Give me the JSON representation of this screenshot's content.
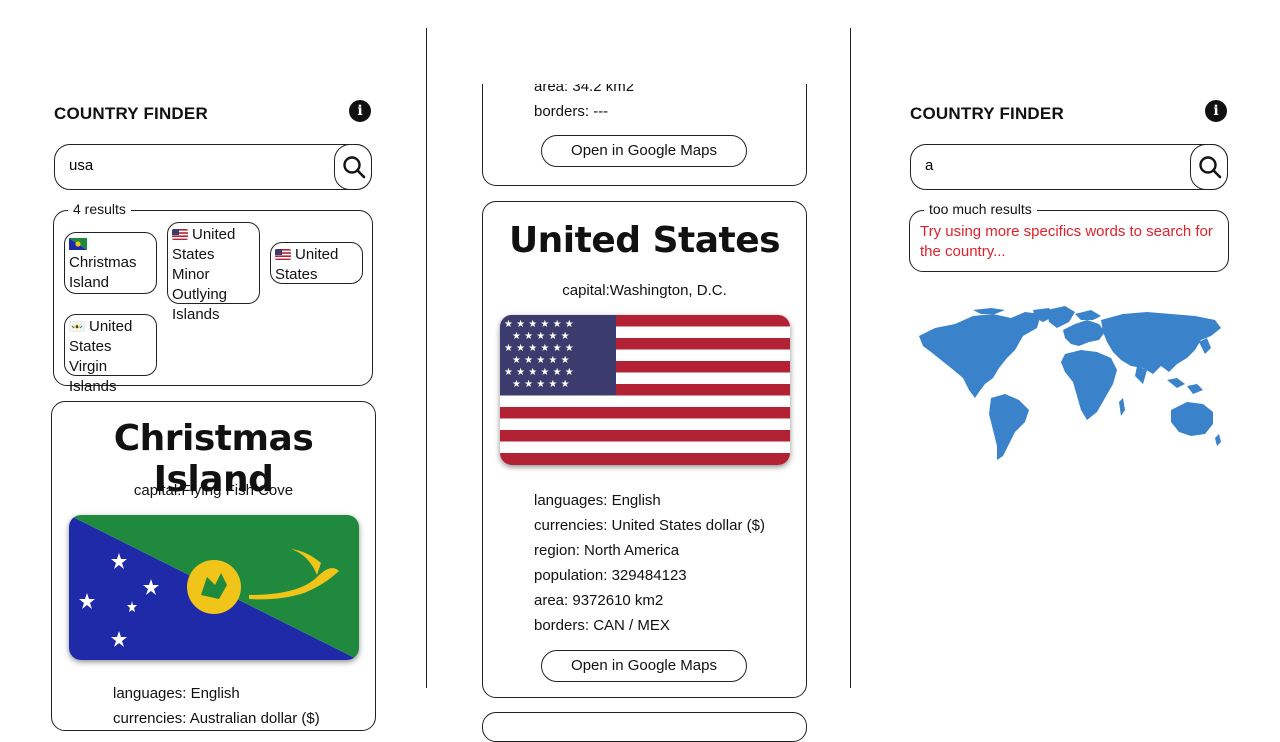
{
  "colors": {
    "accent": "#111111",
    "warning": "#e0202a",
    "map": "#3a82c9",
    "us_red": "#b22234",
    "us_blue": "#3c3b6e",
    "cx_blue": "#1f2aa8",
    "cx_green": "#1f8a3e",
    "cx_yellow": "#f0c419"
  },
  "left": {
    "title": "COUNTRY FINDER",
    "info_icon": "i",
    "search": {
      "value": "usa",
      "icon": "search-icon"
    },
    "results": {
      "legend": "4 results",
      "items": [
        {
          "label": "Christmas Island",
          "flag": "christmas-island-flag"
        },
        {
          "label": "United States Minor Outlying Islands",
          "flag": "us-flag"
        },
        {
          "label": "United States",
          "flag": "us-flag"
        },
        {
          "label": "United States Virgin Islands",
          "flag": "usvi-flag"
        }
      ]
    },
    "card": {
      "name": "Christmas Island",
      "capital": "capital:Flying Fish Cove",
      "languages": "languages: English",
      "currencies": "currencies: Australian dollar ($)"
    }
  },
  "middle": {
    "top_card": {
      "area": "area: 34.2 km2",
      "borders": "borders: ---",
      "maps_button": "Open in Google Maps"
    },
    "card": {
      "name": "United States",
      "capital": "capital:Washington, D.C.",
      "languages": "languages: English",
      "currencies": "currencies: United States dollar ($)",
      "region": "region: North America",
      "population": "population: 329484123",
      "area": "area: 9372610 km2",
      "borders": "borders: CAN / MEX",
      "maps_button": "Open in Google Maps"
    }
  },
  "right": {
    "title": "COUNTRY FINDER",
    "info_icon": "i",
    "search": {
      "value": "a",
      "icon": "search-icon"
    },
    "results": {
      "legend": "too much results",
      "message": "Try using more specifics words to search for the country..."
    },
    "map_icon": "world-map-icon"
  }
}
